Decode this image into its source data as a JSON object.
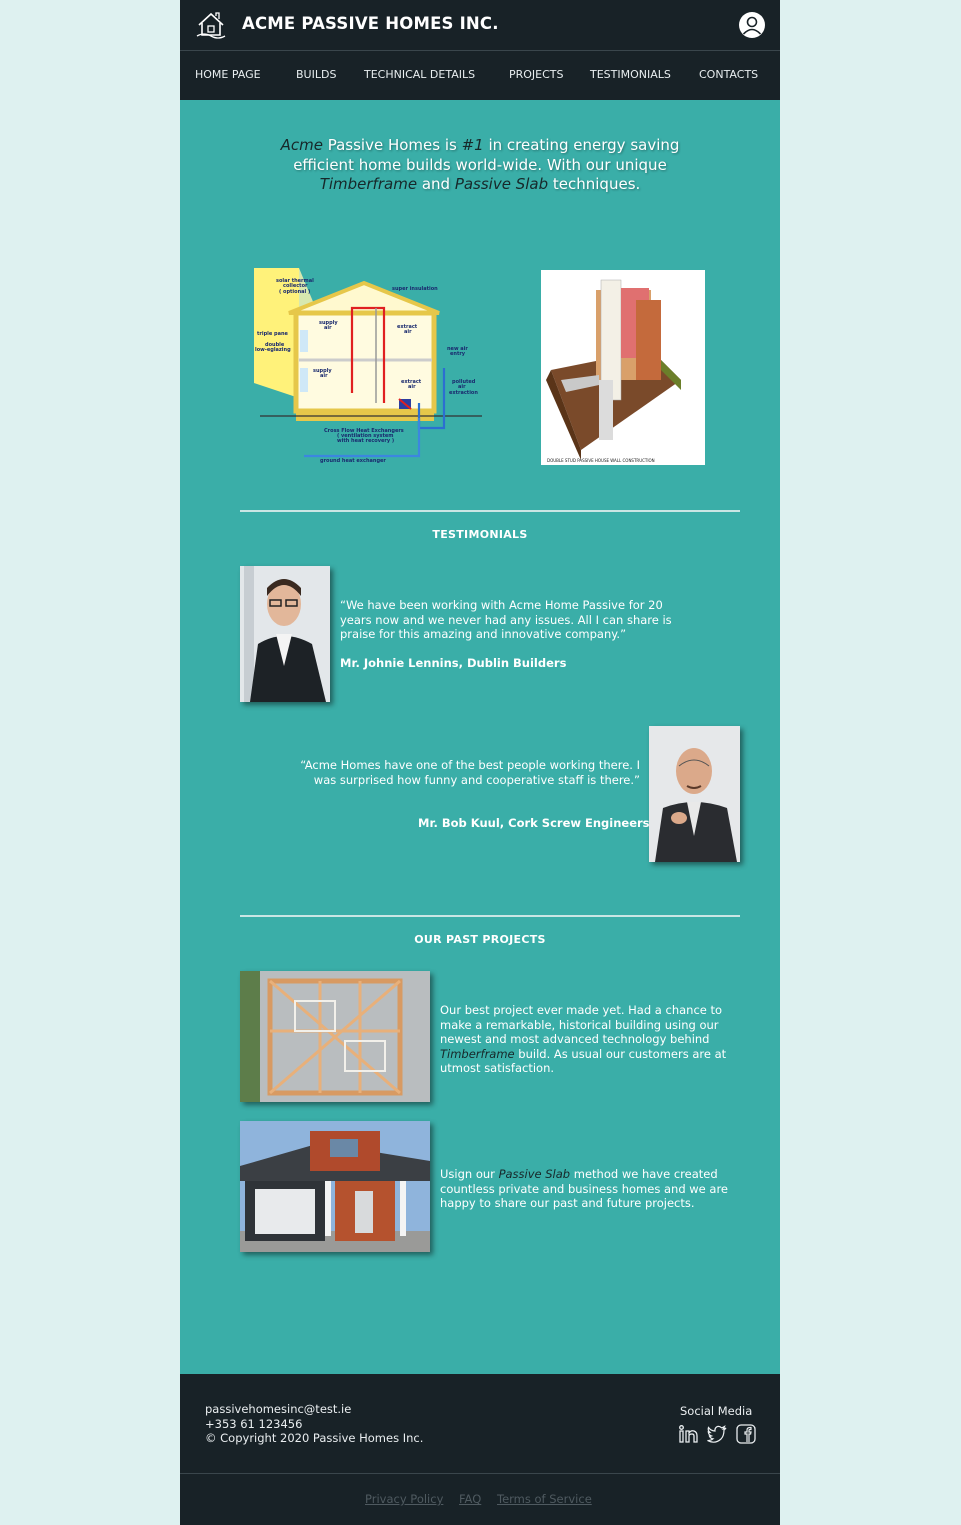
{
  "header": {
    "brand": "ACME PASSIVE HOMES INC."
  },
  "nav": {
    "items": [
      "HOME PAGE",
      "BUILDS",
      "TECHNICAL DETAILS",
      "PROJECTS",
      "TESTIMONIALS",
      "CONTACTS"
    ]
  },
  "hero": {
    "parts": [
      "Acme",
      " Passive Homes is ",
      "#1",
      " in creating energy saving efficient home builds world-wide. With our unique ",
      "Timberframe",
      " and ",
      "Passive Slab",
      " techniques."
    ]
  },
  "diagram": {
    "labels": {
      "solar": [
        "solar thermal",
        "collector",
        "( optional )"
      ],
      "insulation": "super insulation",
      "triple_pane": "triple pane",
      "double_glazing": [
        "double",
        "low-eglazing"
      ],
      "supply_air_top": [
        "supply",
        "air"
      ],
      "extract_air_top": [
        "extract",
        "air"
      ],
      "new_air": [
        "new air",
        "entry"
      ],
      "supply_air_bottom": [
        "supply",
        "air"
      ],
      "extract_air_bottom": [
        "extract",
        "air"
      ],
      "polluted": [
        "polluted",
        "air",
        "extraction"
      ],
      "exchangers": [
        "Cross Flow Heat Exchangers",
        "( ventilation system",
        "with heat recovery )"
      ],
      "ground": "ground heat exchanger"
    },
    "wall_caption": "DOUBLE STUD PASSIVE HOUSE WALL CONSTRUCTION"
  },
  "testimonials": {
    "title": "TESTIMONIALS",
    "items": [
      {
        "quote": "“We have been working with Acme Home Passive for 20 years now and we never had any issues. All I can share is praise for this amazing and innovative company.”",
        "author": "Mr. Johnie Lennins, Dublin Builders"
      },
      {
        "quote": "“Acme Homes have one of the best people working there. I was surprised how funny and cooperative staff is there.”",
        "author": "Mr. Bob Kuul, Cork Screw Engineers"
      }
    ]
  },
  "projects": {
    "title": "OUR PAST PROJECTS",
    "items": [
      {
        "parts": [
          "Our best project ever made yet. Had a chance to make a remarkable, historical building using our newest and most advanced technology behind ",
          "Timberframe",
          " build. As usual our customers are at utmost satisfaction."
        ]
      },
      {
        "parts": [
          "Usign our ",
          "Passive Slab",
          " method we have created countless private and business homes and we are happy to share our past and future projects."
        ]
      }
    ]
  },
  "footer": {
    "email": "passivehomesinc@test.ie",
    "phone": "+353 61 123456",
    "copyright": "© Copyright 2020 Passive Homes Inc.",
    "social_label": "Social Media",
    "social_icons": [
      "linkedin-icon",
      "twitter-icon",
      "facebook-icon"
    ],
    "links": [
      "Privacy Policy",
      "FAQ",
      "Terms of Service"
    ]
  },
  "colors": {
    "page_bg": "#def1f0",
    "content_bg": "#3aaea8",
    "dark": "#182227",
    "accent_text": "#17282a"
  }
}
